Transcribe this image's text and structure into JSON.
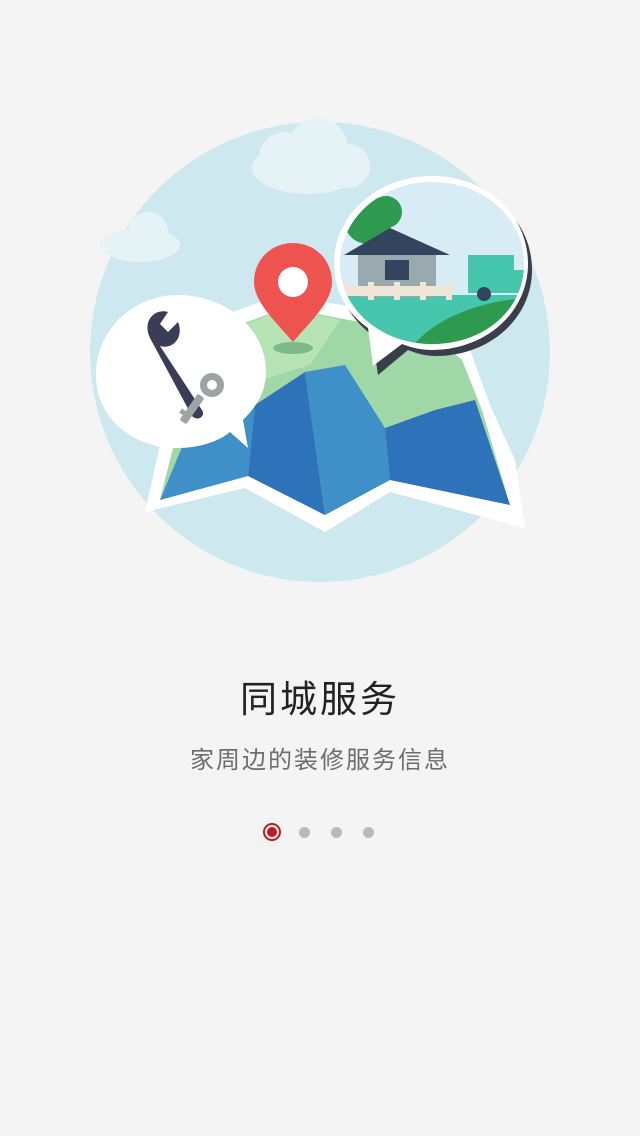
{
  "onboarding": {
    "title": "同城服务",
    "subtitle": "家周边的装修服务信息",
    "page_indicator": {
      "total": 4,
      "current": 1
    },
    "illustration": {
      "icons": [
        "map-icon",
        "location-pin-icon",
        "wrench-icon",
        "key-icon",
        "house-icon",
        "truck-icon",
        "cloud-icon"
      ]
    }
  },
  "colors": {
    "background": "#f4f4f4",
    "accent": "#c8161d",
    "inactive_dot": "#b9b9b9",
    "title": "#222222",
    "subtitle": "#6d6d6d"
  }
}
